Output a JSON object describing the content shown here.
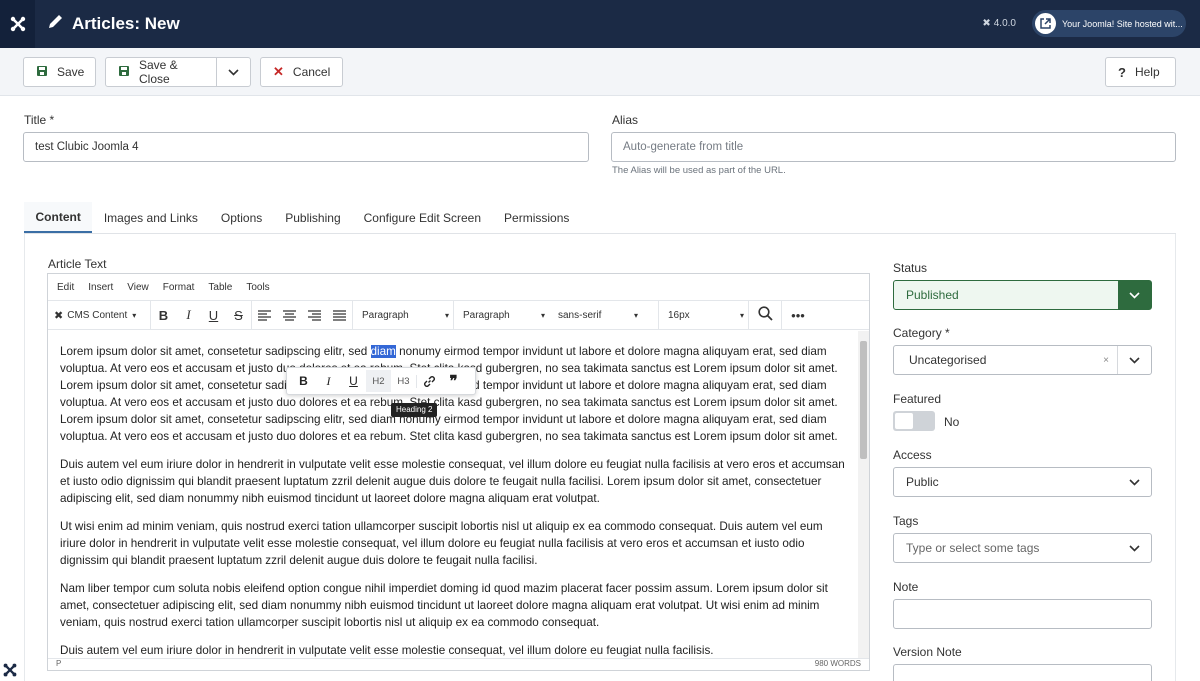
{
  "header": {
    "title": "Articles: New",
    "version": "4.0.0",
    "hosted": "Your Joomla! Site hosted wit..."
  },
  "toolbar": {
    "save": "Save",
    "save_close": "Save & Close",
    "cancel": "Cancel",
    "help": "Help"
  },
  "form": {
    "title_label": "Title *",
    "title_value": "test Clubic Joomla 4",
    "alias_label": "Alias",
    "alias_placeholder": "Auto-generate from title",
    "alias_help": "The Alias will be used as part of the URL."
  },
  "tabs": [
    "Content",
    "Images and Links",
    "Options",
    "Publishing",
    "Configure Edit Screen",
    "Permissions"
  ],
  "editor": {
    "label": "Article Text",
    "menu": [
      "Edit",
      "Insert",
      "View",
      "Format",
      "Table",
      "Tools"
    ],
    "cms_content": "CMS Content",
    "block1": "Paragraph",
    "block2": "Paragraph",
    "font": "sans-serif",
    "size": "16px",
    "status_path": "P",
    "word_count": "980 WORDS",
    "tooltip": "Heading 2",
    "popup_h2": "H2",
    "popup_h3": "H3",
    "highlight": "diam",
    "p1_a": "Lorem ipsum dolor sit amet, consetetur sadipscing elitr, sed ",
    "p1_b": " nonumy eirmod tempor invidunt ut labore et dolore magna aliquyam erat, sed diam voluptua. At vero eos et accusam et justo duo dolores et ea rebum. Stet clita kasd gubergren, no sea takimata sanctus est Lorem ipsum dolor sit amet. Lorem ipsum dolor sit amet, consetetur sadipscing elitr, sed diam nonumy eirmod tempor invidunt ut labore et dolore magna aliquyam erat, sed diam voluptua. At vero eos et accusam et justo duo dolores et ea rebum. Stet clita kasd gubergren, no sea takimata sanctus est Lorem ipsum dolor sit amet. Lorem ipsum dolor sit amet, consetetur sadipscing elitr, sed diam nonumy eirmod tempor invidunt ut labore et dolore magna aliquyam erat, sed diam voluptua. At vero eos et accusam et justo duo dolores et ea rebum. Stet clita kasd gubergren, no sea takimata sanctus est Lorem ipsum dolor sit amet.",
    "p2": "Duis autem vel eum iriure dolor in hendrerit in vulputate velit esse molestie consequat, vel illum dolore eu feugiat nulla facilisis at vero eros et accumsan et iusto odio dignissim qui blandit praesent luptatum zzril delenit augue duis dolore te feugait nulla facilisi. Lorem ipsum dolor sit amet, consectetuer adipiscing elit, sed diam nonummy nibh euismod tincidunt ut laoreet dolore magna aliquam erat volutpat.",
    "p3": "Ut wisi enim ad minim veniam, quis nostrud exerci tation ullamcorper suscipit lobortis nisl ut aliquip ex ea commodo consequat. Duis autem vel eum iriure dolor in hendrerit in vulputate velit esse molestie consequat, vel illum dolore eu feugiat nulla facilisis at vero eros et accumsan et iusto odio dignissim qui blandit praesent luptatum zzril delenit augue duis dolore te feugait nulla facilisi.",
    "p4": "Nam liber tempor cum soluta nobis eleifend option congue nihil imperdiet doming id quod mazim placerat facer possim assum. Lorem ipsum dolor sit amet, consectetuer adipiscing elit, sed diam nonummy nibh euismod tincidunt ut laoreet dolore magna aliquam erat volutpat. Ut wisi enim ad minim veniam, quis nostrud exerci tation ullamcorper suscipit lobortis nisl ut aliquip ex ea commodo consequat.",
    "p5": "Duis autem vel eum iriure dolor in hendrerit in vulputate velit esse molestie consequat, vel illum dolore eu feugiat nulla facilisis."
  },
  "sidebar": {
    "status_label": "Status",
    "status_value": "Published",
    "category_label": "Category *",
    "category_value": "Uncategorised",
    "featured_label": "Featured",
    "featured_value": "No",
    "access_label": "Access",
    "access_value": "Public",
    "tags_label": "Tags",
    "tags_placeholder": "Type or select some tags",
    "note_label": "Note",
    "version_label": "Version Note"
  },
  "colors": {
    "header": "#1b2a45",
    "accent": "#2e6b3e",
    "highlight": "#3367d6"
  }
}
